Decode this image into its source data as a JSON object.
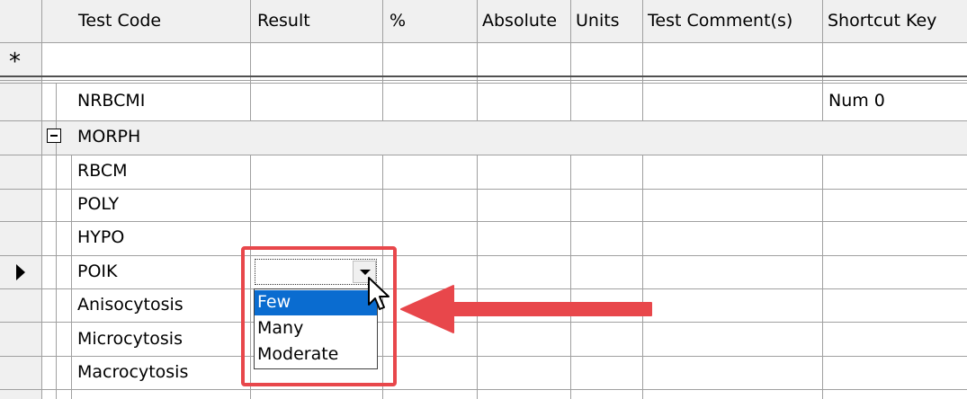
{
  "columns": [
    "Test Code",
    "Result",
    "%",
    "Absolute",
    "Units",
    "Test Comment(s)",
    "Shortcut Key"
  ],
  "new_row_symbol": "*",
  "group_row": {
    "name": "MORPH"
  },
  "rows": [
    {
      "code": "NRBCMI",
      "shortcut": "Num 0"
    },
    {
      "code": "RBCM",
      "shortcut": ""
    },
    {
      "code": "POLY",
      "shortcut": ""
    },
    {
      "code": "HYPO",
      "shortcut": ""
    },
    {
      "code": "POIK",
      "shortcut": ""
    },
    {
      "code": "Anisocytosis",
      "shortcut": ""
    },
    {
      "code": "Microcytosis",
      "shortcut": ""
    },
    {
      "code": "Macrocytosis",
      "shortcut": ""
    }
  ],
  "result_dropdown": {
    "value": "",
    "options": [
      "Few",
      "Many",
      "Moderate"
    ],
    "highlighted_option": "Few"
  },
  "colors": {
    "selection": "#0a6cd0",
    "annotation": "#e8474b",
    "header_bg": "#f0f0f0"
  },
  "icons": {
    "current_row": "triangle-right-icon",
    "collapse": "minus-box-icon",
    "cursor": "arrow-cursor-icon",
    "callout": "red-arrow-icon"
  }
}
